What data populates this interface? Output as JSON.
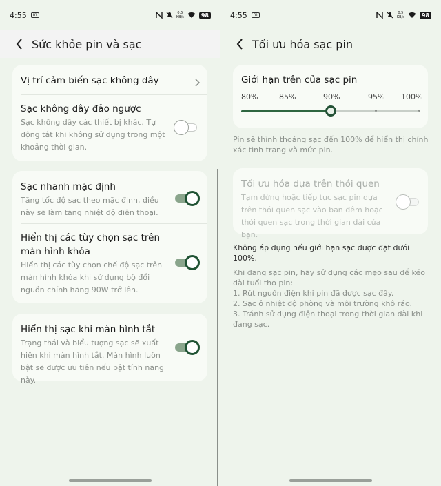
{
  "status": {
    "time": "4:55",
    "sim": "m",
    "speed_top": "0,5",
    "speed_bottom": "KB/s",
    "battery": "98"
  },
  "left": {
    "title": "Sức khỏe pin và sạc",
    "card1": {
      "item1": {
        "title": "Vị trí cảm biến sạc không dây"
      },
      "item2": {
        "title": "Sạc không dây đảo ngược",
        "desc": "Sạc không dây các thiết bị khác. Tự động tắt khi không sử dụng trong một khoảng thời gian.",
        "enabled": false
      }
    },
    "card2": {
      "item1": {
        "title": "Sạc nhanh mặc định",
        "desc": "Tăng tốc độ sạc theo mặc định, điều này sẽ làm tăng nhiệt độ điện thoại.",
        "enabled": true
      },
      "item2": {
        "title": "Hiển thị các tùy chọn sạc trên màn hình khóa",
        "desc": "Hiển thị các tùy chọn chế độ sạc trên màn hình khóa khi sử dụng bộ đổi nguồn chính hãng 90W trở lên.",
        "enabled": true
      }
    },
    "card3": {
      "item1": {
        "title": "Hiển thị sạc khi màn hình tắt",
        "desc": "Trạng thái và biểu tượng sạc sẽ xuất hiện khi màn hình tắt. Màn hình luôn bật sẽ được ưu tiên nếu bật tính năng này.",
        "enabled": true
      }
    }
  },
  "right": {
    "title": "Tối ưu hóa sạc pin",
    "slider": {
      "title": "Giới hạn trên của sạc pin",
      "labels": [
        "80%",
        "85%",
        "90%",
        "95%",
        "100%"
      ],
      "value_index": 2
    },
    "slider_note": "Pin sẽ thỉnh thoảng sạc đến 100% để hiển thị chính xác tình trạng và mức pin.",
    "habit": {
      "title": "Tối ưu hóa dựa trên thói quen",
      "desc": "Tạm dừng hoặc tiếp tục sạc pin dựa trên thói quen sạc vào ban đêm hoặc thói quen sạc trong thời gian dài của bạn.",
      "enabled": false
    },
    "not_apply": "Không áp dụng nếu giới hạn sạc được đặt dưới 100%.",
    "tips": {
      "intro": "Khi đang sạc pin, hãy sử dụng các mẹo sau để kéo dài tuổi thọ pin:",
      "items": [
        "1. Rút nguồn điện khi pin đã được sạc đầy.",
        "2. Sạc ở nhiệt độ phòng và môi trường khô ráo.",
        "3. Tránh sử dụng điện thoại trong thời gian dài khi đang sạc."
      ]
    }
  }
}
